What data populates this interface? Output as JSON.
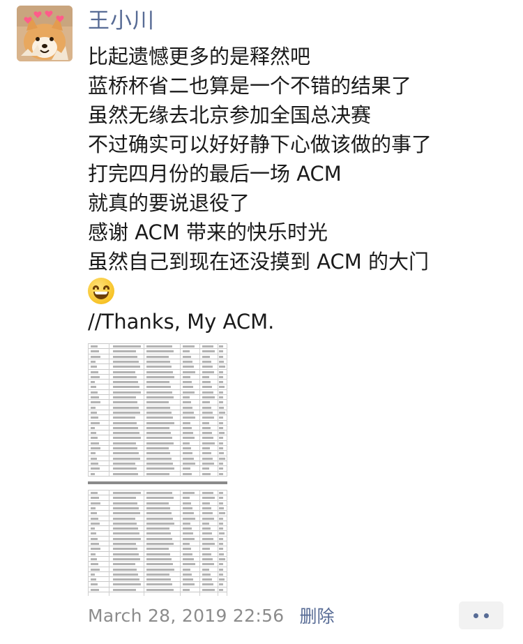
{
  "post": {
    "author": "王小川",
    "lines": [
      "比起遗憾更多的是释然吧",
      "蓝桥杯省二也算是一个不错的结果了",
      "虽然无缘去北京参加全国总决赛",
      "不过确实可以好好静下心做该做的事了",
      "打完四月份的最后一场 ACM",
      "就真的要说退役了",
      "感谢 ACM 带来的快乐时光",
      "虽然自己到现在还没摸到 ACM 的大门"
    ],
    "emoji": "grinning-face-with-smiling-eyes",
    "closing_line": "//Thanks, My ACM.",
    "timestamp": "March 28, 2019 22:56",
    "delete_label": "删除"
  },
  "colors": {
    "author_name": "#576b95",
    "link": "#576b95",
    "timestamp": "#8c8c8c",
    "text": "#1a1a1a",
    "more_button_bg": "#f2f2f2"
  },
  "icons": {
    "avatar": "shiba-dog-with-heart-crown",
    "more": "ellipsis-icon"
  }
}
